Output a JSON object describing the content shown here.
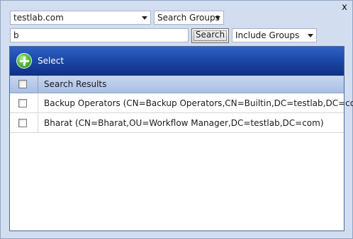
{
  "window": {
    "close_glyph": "x"
  },
  "filters": {
    "domain": {
      "value": "testlab.com",
      "icon": "chevron-down-icon"
    },
    "search_scope": {
      "value": "Search Groups",
      "icon": "chevron-down-icon"
    },
    "query": {
      "value": "b"
    },
    "search_button": "Search",
    "include_mode": {
      "value": "Include Groups",
      "icon": "chevron-down-icon"
    }
  },
  "toolbar": {
    "select_label": "Select",
    "icon": "add-circle-icon"
  },
  "results": {
    "header": "Search Results",
    "rows": [
      "Backup Operators (CN=Backup Operators,CN=Builtin,DC=testlab,DC=com)",
      "Bharat (CN=Bharat,OU=Workflow Manager,DC=testlab,DC=com)"
    ]
  },
  "colors": {
    "window_bg": "#d2def0",
    "toolbar_top": "#2e62c4",
    "toolbar_bottom": "#0f2f84",
    "header_bg": "#b8cbe9",
    "add_icon": "#52c03c"
  }
}
